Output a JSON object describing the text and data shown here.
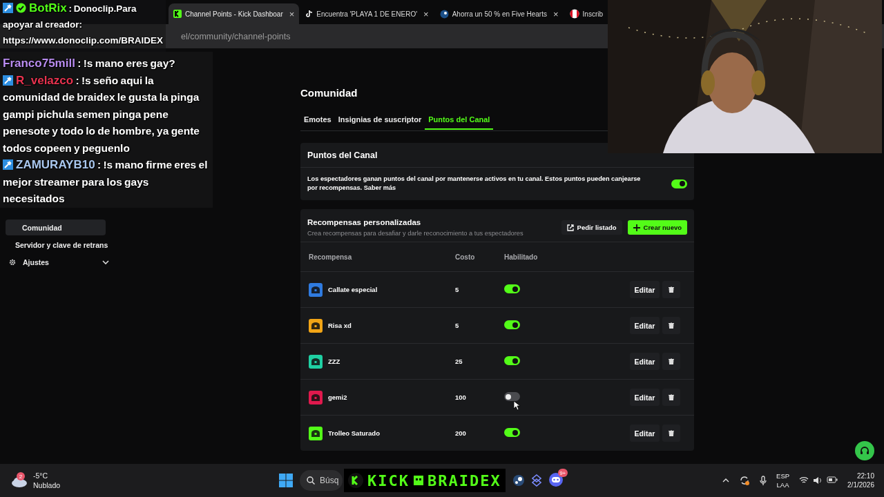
{
  "chat_overlay": {
    "messages": [
      {
        "user": "BotRix",
        "color": "#53fc18",
        "moderator": true,
        "verified": true,
        "text": ": Donoclip.Para apoyar al creador: https://www.donoclip.com/BRAIDEX"
      },
      {
        "user": "Franco75mill",
        "color": "#b98cf0",
        "moderator": false,
        "verified": false,
        "text": ": !s mano eres gay?"
      },
      {
        "user": "R_velazco",
        "color": "#e8334f",
        "moderator": true,
        "verified": false,
        "text": ": !s seño aqui la comunidad de braidex le gusta la pinga gampi pichula semen pinga pene penesote y todo lo de hombre, ya gente todos copeen y peguenlo"
      },
      {
        "user": "ZAMURAYB10",
        "color": "#a9c7ee",
        "moderator": true,
        "verified": false,
        "text": ": !s mano firme eres el mejor streamer para los gays necesitados"
      }
    ]
  },
  "browser": {
    "tabs": [
      {
        "title": "Channel Points - Kick Dashboar",
        "kind": "kick",
        "selected": true,
        "close": "×"
      },
      {
        "title": "Encuentra 'PLAYA 1 DE ENERO'",
        "kind": "tiktok",
        "selected": false,
        "close": "×"
      },
      {
        "title": "Ahorra un 50 % en Five Hearts",
        "kind": "steam",
        "selected": false,
        "close": "×"
      },
      {
        "title": "Inscrib",
        "kind": "flag",
        "selected": false
      }
    ],
    "address": "el/community/channel-points"
  },
  "sidebar": {
    "items": [
      {
        "label": "Comunidad",
        "kind": "sub",
        "selected": true
      },
      {
        "label": "Servidor y clave de retrans",
        "kind": "sub",
        "selected": false
      },
      {
        "label": "Ajustes",
        "kind": "group",
        "selected": false
      }
    ]
  },
  "page": {
    "title": "Comunidad",
    "tabs": [
      {
        "label": "Emotes",
        "selected": false
      },
      {
        "label": "Insignias de suscriptor",
        "selected": false
      },
      {
        "label": "Puntos del Canal",
        "selected": true
      }
    ],
    "channel_points": {
      "title": "Puntos del Canal",
      "description": "Los espectadores ganan puntos del canal por mantenerse activos en tu canal. Estos puntos pueden canjearse por recompensas. Saber más",
      "on": true
    },
    "rewards": {
      "title": "Recompensas personalizadas",
      "subtitle": "Crea recompensas para desafiar y darle reconocimiento a tus espectadores",
      "buttons": [
        {
          "label": "Pedir listado",
          "kind": "secondary"
        },
        {
          "label": "Crear nuevo",
          "kind": "primary"
        }
      ],
      "columns": [
        "Recompensa",
        "Costo",
        "Habilitado"
      ],
      "rows": [
        {
          "name": "Callate especial",
          "cost": "5",
          "enabled": true,
          "color": "#2f7be0",
          "action": "Editar"
        },
        {
          "name": "Risa xd",
          "cost": "5",
          "enabled": true,
          "color": "#f2a516",
          "action": "Editar"
        },
        {
          "name": "ZZZ",
          "cost": "25",
          "enabled": true,
          "color": "#1fd0a3",
          "action": "Editar"
        },
        {
          "name": "gemi2",
          "cost": "100",
          "enabled": false,
          "color": "#e0194d",
          "action": "Editar"
        },
        {
          "name": "Trolleo Saturado",
          "cost": "200",
          "enabled": true,
          "color": "#53fc18",
          "action": "Editar"
        }
      ]
    }
  },
  "taskbar": {
    "weather": {
      "badge": "2",
      "temp": "-5°C",
      "condition": "Nublado"
    },
    "search": {
      "placeholder": "Búsq"
    },
    "banner": "KICK",
    "banner_name": "BRAIDEX",
    "discord_badge": "9+",
    "language": "ESP",
    "layout": "LAA",
    "time": "22:10",
    "date": "2/1/2026"
  }
}
